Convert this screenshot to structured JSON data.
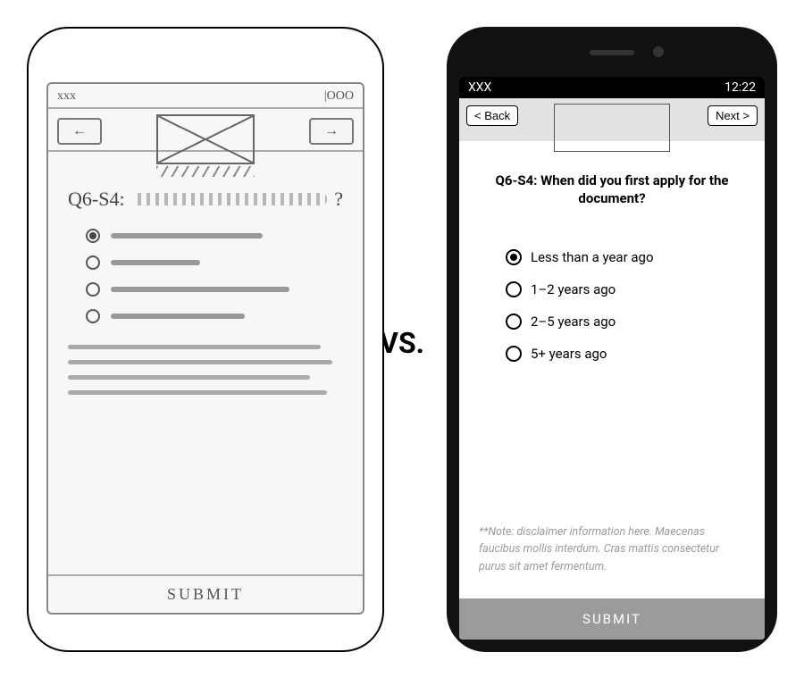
{
  "vs_label": "VS.",
  "sketch": {
    "status_left": "xxx",
    "status_right": "|OOO",
    "back_glyph": "←",
    "next_glyph": "→",
    "question_id": "Q6-S4:",
    "question_mark": "?",
    "line_widths": [
      170,
      100,
      200,
      150
    ],
    "submit": "SUBMIT"
  },
  "real": {
    "status_left": "XXX",
    "status_right": "12:22",
    "back_label": "< Back",
    "next_label": "Next >",
    "question": "Q6-S4: When did you first apply for the document?",
    "options": [
      "Less than a year ago",
      "1–2 years ago",
      "2–5 years ago",
      "5+ years ago"
    ],
    "selected_index": 0,
    "note": "**Note: disclaimer information here. Maecenas faucibus mollis interdum. Cras mattis consectetur purus sit amet fermentum.",
    "submit": "SUBMIT"
  }
}
